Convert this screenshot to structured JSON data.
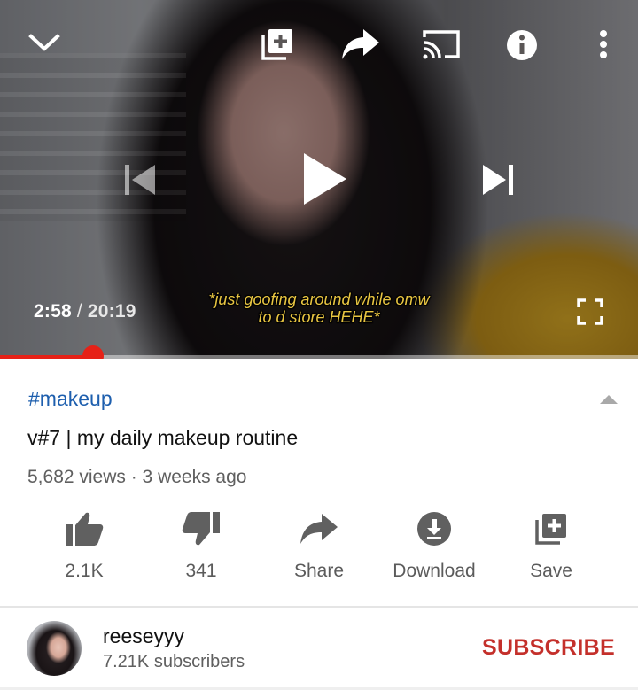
{
  "player": {
    "current_time": "2:58",
    "separator": "/",
    "total_time": "20:19",
    "caption_line1": "*just goofing around while omw",
    "caption_line2": "to d store HEHE*",
    "progress": 0.146,
    "accent_color": "#e62117",
    "icons": {
      "minimize": "chevron-down-icon",
      "add_to_playlist": "add-to-playlist-icon",
      "share": "share-arrow-icon",
      "cast": "cast-icon",
      "info": "info-icon",
      "more": "more-vert-icon",
      "previous": "skip-previous-icon",
      "play": "play-icon",
      "next": "skip-next-icon",
      "fullscreen": "fullscreen-icon"
    }
  },
  "video": {
    "hashtag": "#makeup",
    "title": "v#7 | my daily makeup routine",
    "meta": "5,682 views · 3 weeks ago",
    "hashtag_color": "#1e5fae"
  },
  "actions": [
    {
      "label": "2.1K",
      "icon": "thumbs-up-icon"
    },
    {
      "label": "341",
      "icon": "thumbs-down-icon"
    },
    {
      "label": "Share",
      "icon": "share-icon"
    },
    {
      "label": "Download",
      "icon": "download-icon"
    },
    {
      "label": "Save",
      "icon": "save-icon"
    }
  ],
  "channel": {
    "name": "reeseyyy",
    "subscribers": "7.21K subscribers",
    "subscribe_label": "SUBSCRIBE",
    "subscribe_color": "#c4302b"
  }
}
